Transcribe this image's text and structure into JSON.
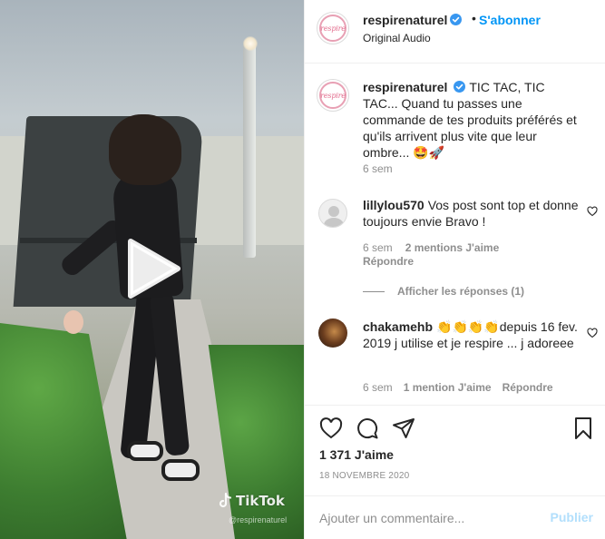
{
  "video": {
    "watermark": "TikTok",
    "watermark_handle": "@respirenaturel"
  },
  "header": {
    "username": "respirenaturel",
    "follow_label": "S'abonner",
    "audio_label": "Original Audio",
    "avatar_logo": "respire"
  },
  "caption": {
    "username": "respirenaturel",
    "text": "TIC TAC, TIC TAC... Quand tu passes une commande de tes produits préférés et qu'ils arrivent plus vite que leur ombre... 🤩🚀",
    "time": "6 sem"
  },
  "comments": [
    {
      "username": "lillylou570",
      "text": "Vos post sont top et donne toujours envie Bravo !",
      "time": "6 sem",
      "likes": "2 mentions J'aime",
      "reply": "Répondre"
    },
    {
      "username": "chakamehb",
      "text": "👏👏👏👏depuis 16 fev. 2019 j utilise et je respire ... j adoreee",
      "time": "6 sem",
      "likes": "1 mention J'aime",
      "reply": "Répondre"
    }
  ],
  "view_replies": "Afficher les réponses (1)",
  "post": {
    "likes": "1 371 J'aime",
    "date": "18 NOVEMBRE 2020"
  },
  "add_comment": {
    "placeholder": "Ajouter un commentaire...",
    "publish_label": "Publier"
  },
  "colors": {
    "accent_blue": "#0095f6",
    "publish_disabled": "#b2dffc",
    "muted_text": "#8e8e8e",
    "brand_pink": "#e26b8c"
  },
  "icons": [
    "play-icon",
    "tiktok-icon",
    "verified-icon",
    "heart-icon",
    "comment-icon",
    "share-icon",
    "bookmark-icon",
    "heart-small-icon"
  ]
}
